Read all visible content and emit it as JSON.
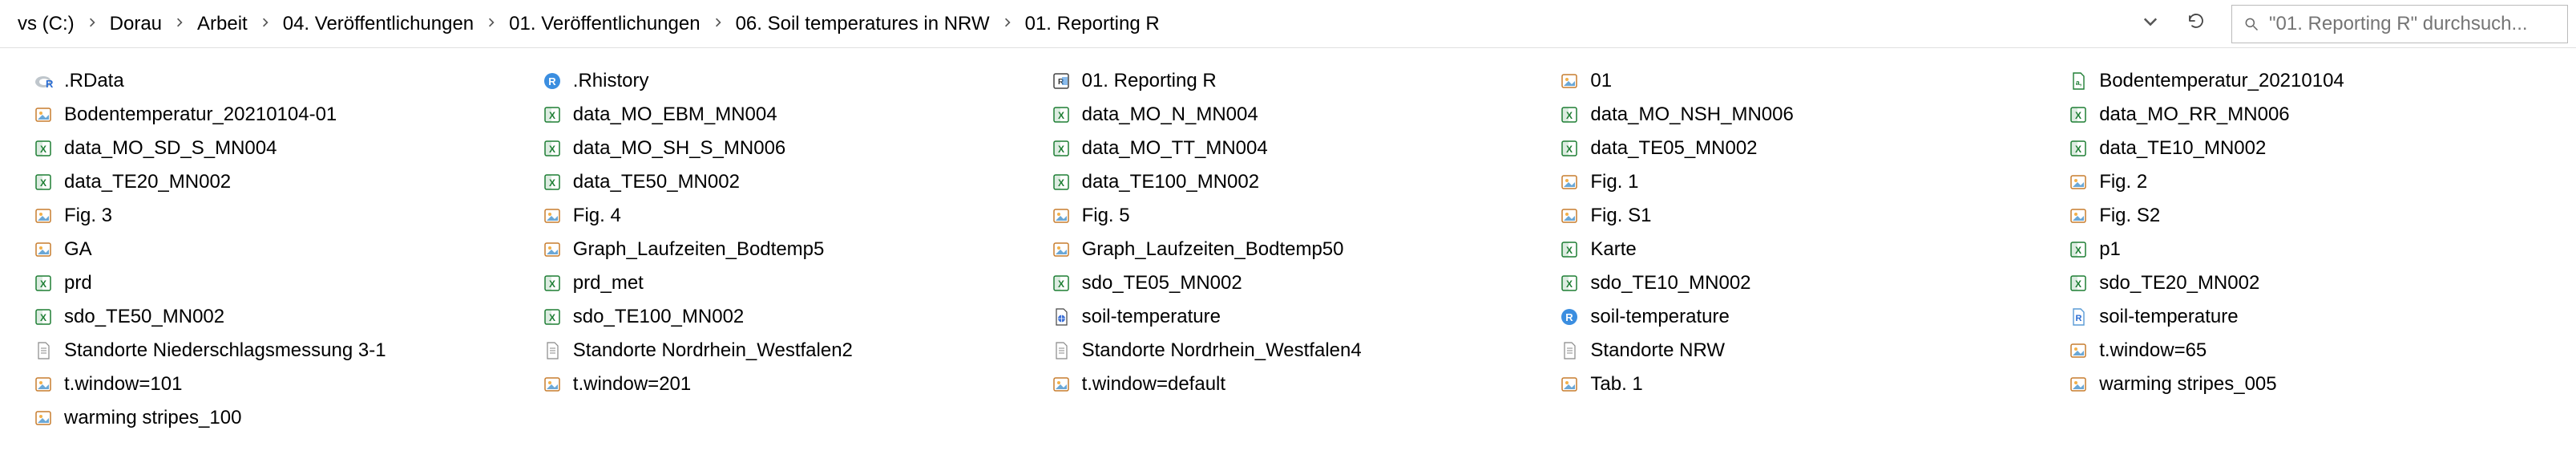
{
  "breadcrumb": {
    "items": [
      {
        "label": "vs (C:)"
      },
      {
        "label": "Dorau"
      },
      {
        "label": "Arbeit"
      },
      {
        "label": "04. Veröffentlichungen"
      },
      {
        "label": "01. Veröffentlichungen"
      },
      {
        "label": "06. Soil temperatures in NRW"
      },
      {
        "label": "01. Reporting R"
      }
    ]
  },
  "search": {
    "placeholder": "\"01. Reporting R\" durchsuch..."
  },
  "columns": [
    [
      {
        "icon": "rdata",
        "label": ".RData"
      },
      {
        "icon": "png",
        "label": "Bodentemperatur_20210104-01"
      },
      {
        "icon": "xlsx",
        "label": "data_MO_SD_S_MN004"
      },
      {
        "icon": "xlsx",
        "label": "data_TE20_MN002"
      },
      {
        "icon": "png",
        "label": "Fig. 3"
      },
      {
        "icon": "png",
        "label": "GA"
      },
      {
        "icon": "xlsx",
        "label": "prd"
      },
      {
        "icon": "xlsx",
        "label": "sdo_TE50_MN002"
      },
      {
        "icon": "txt",
        "label": "Standorte Niederschlagsmessung 3-1"
      },
      {
        "icon": "png",
        "label": "t.window=101"
      },
      {
        "icon": "png",
        "label": "warming stripes_100"
      }
    ],
    [
      {
        "icon": "rhist",
        "label": ".Rhistory"
      },
      {
        "icon": "xlsx",
        "label": "data_MO_EBM_MN004"
      },
      {
        "icon": "xlsx",
        "label": "data_MO_SH_S_MN006"
      },
      {
        "icon": "xlsx",
        "label": "data_TE50_MN002"
      },
      {
        "icon": "png",
        "label": "Fig. 4"
      },
      {
        "icon": "png",
        "label": "Graph_Laufzeiten_Bodtemp5"
      },
      {
        "icon": "xlsx",
        "label": "prd_met"
      },
      {
        "icon": "xlsx",
        "label": "sdo_TE100_MN002"
      },
      {
        "icon": "txt",
        "label": "Standorte Nordrhein_Westfalen2"
      },
      {
        "icon": "png",
        "label": "t.window=201"
      }
    ],
    [
      {
        "icon": "rproj",
        "label": "01. Reporting R"
      },
      {
        "icon": "xlsx",
        "label": "data_MO_N_MN004"
      },
      {
        "icon": "xlsx",
        "label": "data_MO_TT_MN004"
      },
      {
        "icon": "xlsx",
        "label": "data_TE100_MN002"
      },
      {
        "icon": "png",
        "label": "Fig. 5"
      },
      {
        "icon": "png",
        "label": "Graph_Laufzeiten_Bodtemp50"
      },
      {
        "icon": "xlsx",
        "label": "sdo_TE05_MN002"
      },
      {
        "icon": "html",
        "label": "soil-temperature"
      },
      {
        "icon": "txt",
        "label": "Standorte Nordrhein_Westfalen4"
      },
      {
        "icon": "png",
        "label": "t.window=default"
      }
    ],
    [
      {
        "icon": "png",
        "label": "01"
      },
      {
        "icon": "xlsx",
        "label": "data_MO_NSH_MN006"
      },
      {
        "icon": "xlsx",
        "label": "data_TE05_MN002"
      },
      {
        "icon": "png",
        "label": "Fig. 1"
      },
      {
        "icon": "png",
        "label": "Fig. S1"
      },
      {
        "icon": "xlsx",
        "label": "Karte"
      },
      {
        "icon": "xlsx",
        "label": "sdo_TE10_MN002"
      },
      {
        "icon": "r",
        "label": "soil-temperature"
      },
      {
        "icon": "txt",
        "label": "Standorte NRW"
      },
      {
        "icon": "png",
        "label": "Tab. 1"
      }
    ],
    [
      {
        "icon": "csv",
        "label": "Bodentemperatur_20210104"
      },
      {
        "icon": "xlsx",
        "label": "data_MO_RR_MN006"
      },
      {
        "icon": "xlsx",
        "label": "data_TE10_MN002"
      },
      {
        "icon": "png",
        "label": "Fig. 2"
      },
      {
        "icon": "png",
        "label": "Fig. S2"
      },
      {
        "icon": "xlsx",
        "label": "p1"
      },
      {
        "icon": "xlsx",
        "label": "sdo_TE20_MN002"
      },
      {
        "icon": "rfile",
        "label": "soil-temperature"
      },
      {
        "icon": "png",
        "label": "t.window=65"
      },
      {
        "icon": "png",
        "label": "warming stripes_005"
      }
    ]
  ],
  "icons": {
    "sep": "›"
  }
}
